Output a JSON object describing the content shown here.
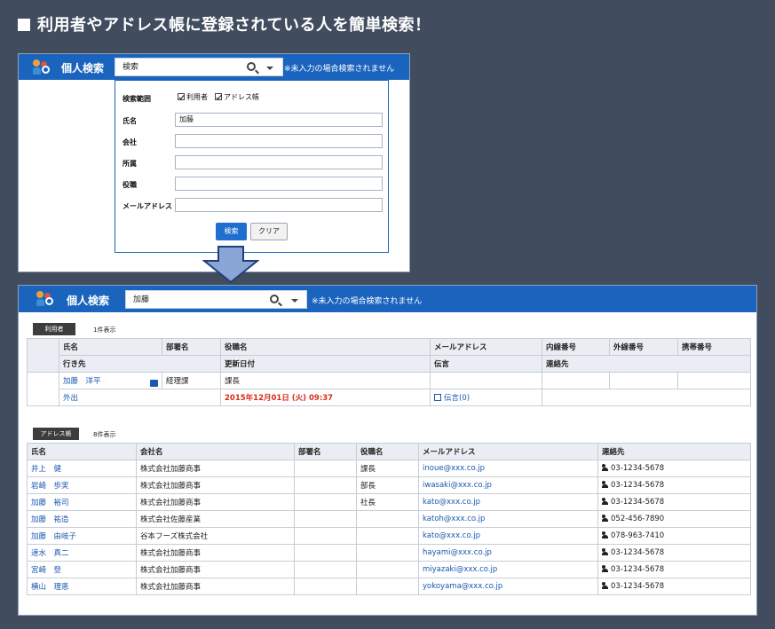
{
  "headline": "利用者やアドレス帳に登録されている人を簡単検索！",
  "app": {
    "name": "個人検索",
    "search_placeholder": "検索",
    "search_value": "加藤",
    "note": "※未入力の場合検索されません"
  },
  "form": {
    "scope_label": "検索範囲",
    "scope_users": "利用者",
    "scope_addressbook": "アドレス帳",
    "name_label": "氏名",
    "name_value": "加藤",
    "company_label": "会社",
    "dept_label": "所属",
    "position_label": "役職",
    "email_label": "メールアドレス",
    "search_button": "検索",
    "clear_button": "クリア"
  },
  "users_section": {
    "tag": "利用者",
    "count": "1件表示",
    "headers_row1": [
      "氏名",
      "部署名",
      "役職名",
      "メールアドレス",
      "内線番号",
      "外線番号",
      "携帯番号"
    ],
    "headers_row2": [
      "行き先",
      "更新日付",
      "伝言",
      "連絡先"
    ],
    "row": {
      "name": "加藤　洋平",
      "dept": "経理課",
      "position": "課長",
      "destination": "外出",
      "updated": "2015年12月01日 (火) 09:37",
      "message": "伝言(0)"
    }
  },
  "address_section": {
    "tag": "アドレス帳",
    "count": "8件表示",
    "headers": [
      "氏名",
      "会社名",
      "部署名",
      "役職名",
      "メールアドレス",
      "連絡先"
    ],
    "rows": [
      {
        "name": "井上　健",
        "company": "株式会社加藤商事",
        "dept": "",
        "position": "課長",
        "email": "inoue@xxx.co.jp",
        "phone": "03-1234-5678"
      },
      {
        "name": "岩崎　歩実",
        "company": "株式会社加藤商事",
        "dept": "",
        "position": "部長",
        "email": "iwasaki@xxx.co.jp",
        "phone": "03-1234-5678"
      },
      {
        "name": "加藤　裕司",
        "company": "株式会社加藤商事",
        "dept": "",
        "position": "社長",
        "email": "kato@xxx.co.jp",
        "phone": "03-1234-5678"
      },
      {
        "name": "加藤　祐造",
        "company": "株式会社佐藤産業",
        "dept": "",
        "position": "",
        "email": "katoh@xxx.co.jp",
        "phone": "052-456-7890"
      },
      {
        "name": "加藤　由岐子",
        "company": "谷本フーズ株式会社",
        "dept": "",
        "position": "",
        "email": "kato@xxx.co.jp",
        "phone": "078-963-7410"
      },
      {
        "name": "速水　真二",
        "company": "株式会社加藤商事",
        "dept": "",
        "position": "",
        "email": "hayami@xxx.co.jp",
        "phone": "03-1234-5678"
      },
      {
        "name": "宮崎　登",
        "company": "株式会社加藤商事",
        "dept": "",
        "position": "",
        "email": "miyazaki@xxx.co.jp",
        "phone": "03-1234-5678"
      },
      {
        "name": "横山　理恵",
        "company": "株式会社加藤商事",
        "dept": "",
        "position": "",
        "email": "yokoyama@xxx.co.jp",
        "phone": "03-1234-5678"
      }
    ]
  },
  "colors": {
    "background": "#414d5f",
    "appbar": "#1b64be",
    "link": "#1b57b0",
    "alert": "#d62c1a"
  }
}
